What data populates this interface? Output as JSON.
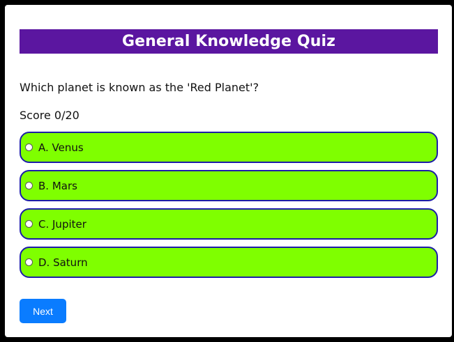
{
  "quiz": {
    "title": "General Knowledge Quiz",
    "question": "Which planet is known as the 'Red Planet'?",
    "score_text": "Score 0/20",
    "options": [
      {
        "label": "A. Venus"
      },
      {
        "label": "B. Mars"
      },
      {
        "label": "C. Jupiter"
      },
      {
        "label": "D. Saturn"
      }
    ],
    "next_label": "Next"
  },
  "colors": {
    "title_bar": "#5b16a0",
    "option_background": "#7fff00",
    "option_border": "#1c1ca8",
    "next_button": "#0a7cff"
  }
}
